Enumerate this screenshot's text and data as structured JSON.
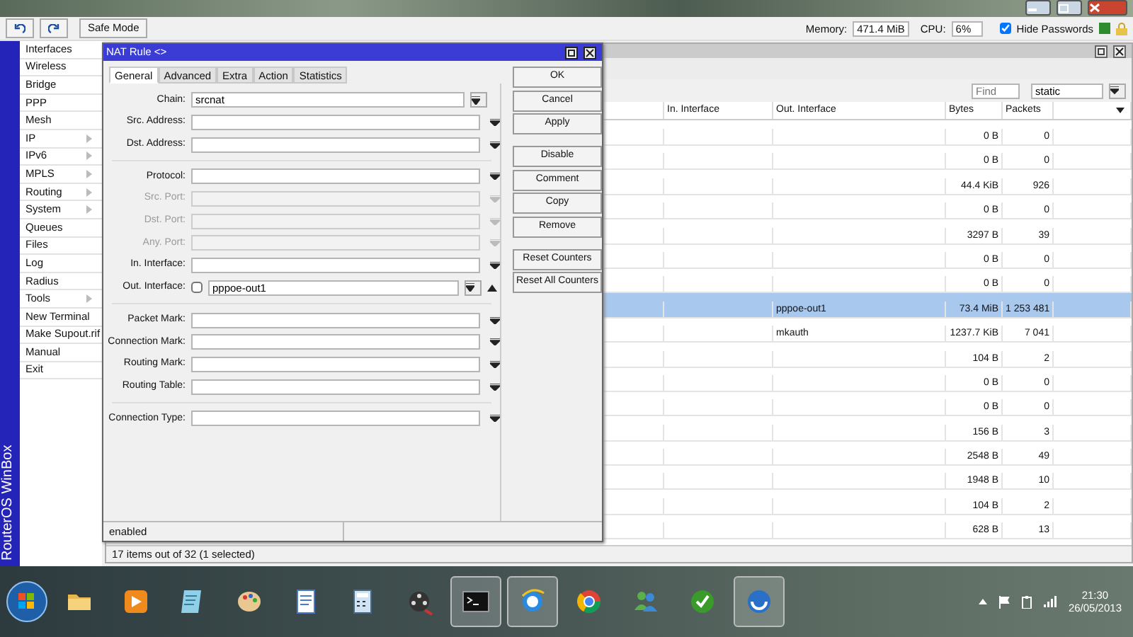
{
  "toolbar": {
    "safe_mode": "Safe Mode",
    "memory_label": "Memory:",
    "memory": "471.4 MiB",
    "cpu_label": "CPU:",
    "cpu": "6%",
    "hide_passwords": {
      "label": "Hide Passwords",
      "checked": true
    }
  },
  "sidebar": {
    "brand": "RouterOS WinBox",
    "items": [
      {
        "label": "Interfaces",
        "submenu": false
      },
      {
        "label": "Wireless",
        "submenu": false
      },
      {
        "label": "Bridge",
        "submenu": false
      },
      {
        "label": "PPP",
        "submenu": false
      },
      {
        "label": "Mesh",
        "submenu": false
      },
      {
        "label": "IP",
        "submenu": true
      },
      {
        "label": "IPv6",
        "submenu": true
      },
      {
        "label": "MPLS",
        "submenu": true
      },
      {
        "label": "Routing",
        "submenu": true
      },
      {
        "label": "System",
        "submenu": true
      },
      {
        "label": "Queues",
        "submenu": false
      },
      {
        "label": "Files",
        "submenu": false
      },
      {
        "label": "Log",
        "submenu": false
      },
      {
        "label": "Radius",
        "submenu": false
      },
      {
        "label": "Tools",
        "submenu": true
      },
      {
        "label": "New Terminal",
        "submenu": false
      },
      {
        "label": "Make Supout.rif",
        "submenu": false
      },
      {
        "label": "Manual",
        "submenu": false
      },
      {
        "label": "Exit",
        "submenu": false
      }
    ]
  },
  "list_window": {
    "find_placeholder": "Find",
    "filter": "static",
    "columns": [
      "In. Interface",
      "Out. Interface",
      "Bytes",
      "Packets"
    ],
    "rows": [
      {
        "bytes": "0 B",
        "packets": "0",
        "selected": false
      },
      {
        "bytes": "0 B",
        "packets": "0",
        "selected": false
      },
      {
        "bytes": "44.4 KiB",
        "packets": "926",
        "selected": false
      },
      {
        "bytes": "0 B",
        "packets": "0",
        "selected": false
      },
      {
        "bytes": "3297 B",
        "packets": "39",
        "selected": false
      },
      {
        "bytes": "0 B",
        "packets": "0",
        "selected": false
      },
      {
        "bytes": "0 B",
        "packets": "0",
        "selected": false
      },
      {
        "out_interface": "pppoe-out1",
        "bytes": "73.4 MiB",
        "packets": "1 253 481",
        "selected": true
      },
      {
        "out_interface": "mkauth",
        "bytes": "1237.7 KiB",
        "packets": "7 041",
        "selected": false
      },
      {
        "bytes": "104 B",
        "packets": "2",
        "selected": false
      },
      {
        "bytes": "0 B",
        "packets": "0",
        "selected": false
      },
      {
        "bytes": "0 B",
        "packets": "0",
        "selected": false
      },
      {
        "bytes": "156 B",
        "packets": "3",
        "selected": false
      },
      {
        "bytes": "2548 B",
        "packets": "49",
        "selected": false
      },
      {
        "bytes": "1948 B",
        "packets": "10",
        "selected": false
      },
      {
        "bytes": "104 B",
        "packets": "2",
        "selected": false
      },
      {
        "bytes": "628 B",
        "packets": "13",
        "selected": false
      }
    ],
    "status": "17 items out of 32 (1 selected)"
  },
  "dialog": {
    "title": "NAT Rule <>",
    "tabs": [
      {
        "label": "General",
        "selected": true
      },
      {
        "label": "Advanced",
        "selected": false
      },
      {
        "label": "Extra",
        "selected": false
      },
      {
        "label": "Action",
        "selected": false
      },
      {
        "label": "Statistics",
        "selected": false
      }
    ],
    "groups": [
      [
        {
          "label": "Chain:",
          "kind": "select",
          "value": "srcnat",
          "disabled": false
        },
        {
          "label": "Src. Address:",
          "kind": "combo",
          "disabled": false
        },
        {
          "label": "Dst. Address:",
          "kind": "combo",
          "disabled": false
        }
      ],
      [
        {
          "label": "Protocol:",
          "kind": "combo",
          "disabled": false
        },
        {
          "label": "Src. Port:",
          "kind": "combo",
          "disabled": true
        },
        {
          "label": "Dst. Port:",
          "kind": "combo",
          "disabled": true
        },
        {
          "label": "Any. Port:",
          "kind": "combo",
          "disabled": true
        },
        {
          "label": "In. Interface:",
          "kind": "combo",
          "disabled": false
        },
        {
          "label": "Out. Interface:",
          "kind": "negatable",
          "value": "pppoe-out1",
          "negated": false,
          "disabled": false
        }
      ],
      [
        {
          "label": "Packet Mark:",
          "kind": "combo",
          "disabled": false
        },
        {
          "label": "Connection Mark:",
          "kind": "combo",
          "disabled": false
        },
        {
          "label": "Routing Mark:",
          "kind": "combo",
          "disabled": false
        },
        {
          "label": "Routing Table:",
          "kind": "combo",
          "disabled": false
        }
      ],
      [
        {
          "label": "Connection Type:",
          "kind": "combo",
          "disabled": false
        }
      ]
    ],
    "button_groups": [
      [
        "OK",
        "Cancel",
        "Apply"
      ],
      [
        "Disable",
        "Comment",
        "Copy",
        "Remove"
      ],
      [
        "Reset Counters",
        "Reset All Counters"
      ]
    ],
    "status": "enabled"
  },
  "taskbar": {
    "apps": [
      {
        "kind": "folder",
        "active": false
      },
      {
        "kind": "media",
        "active": false
      },
      {
        "kind": "notepad",
        "active": false
      },
      {
        "kind": "paint",
        "active": false
      },
      {
        "kind": "document",
        "active": false
      },
      {
        "kind": "calculator",
        "active": false
      },
      {
        "kind": "film",
        "active": false
      },
      {
        "kind": "terminal",
        "active": true
      },
      {
        "kind": "globe",
        "active": true
      },
      {
        "kind": "ball",
        "active": false
      },
      {
        "kind": "people",
        "active": false
      },
      {
        "kind": "green",
        "active": false
      },
      {
        "kind": "winbox",
        "active": true
      }
    ],
    "time": "21:30",
    "date": "26/05/2013"
  }
}
